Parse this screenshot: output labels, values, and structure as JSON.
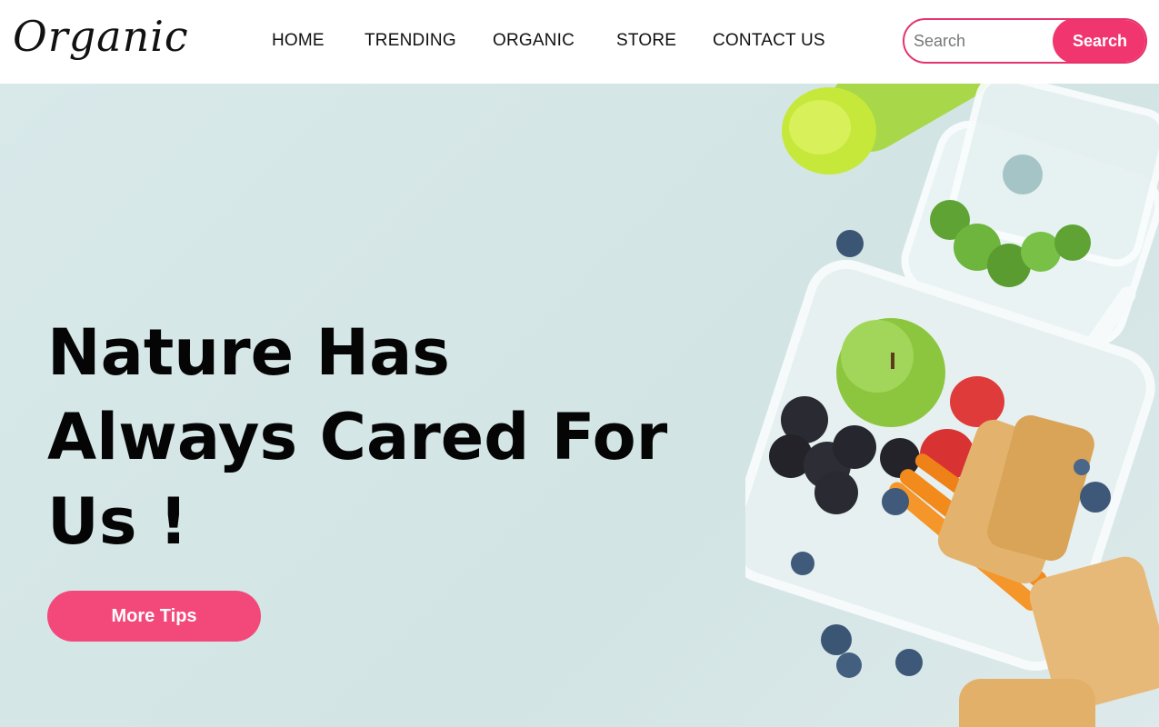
{
  "brand": {
    "logo_text": "Organic"
  },
  "nav": {
    "items": [
      {
        "label": "HOME"
      },
      {
        "label": "TRENDING"
      },
      {
        "label": "ORGANIC"
      },
      {
        "label": "STORE"
      },
      {
        "label": "CONTACT US"
      }
    ]
  },
  "search": {
    "placeholder": "Search",
    "button_label": "Search"
  },
  "hero": {
    "title_lines": [
      "Nature Has",
      "Always Cared For",
      "Us !"
    ],
    "cta_label": "More Tips"
  },
  "colors": {
    "accent": "#f1356f",
    "cta": "#f2497a",
    "hero_bg": "#d6e7e8",
    "text": "#111111"
  }
}
